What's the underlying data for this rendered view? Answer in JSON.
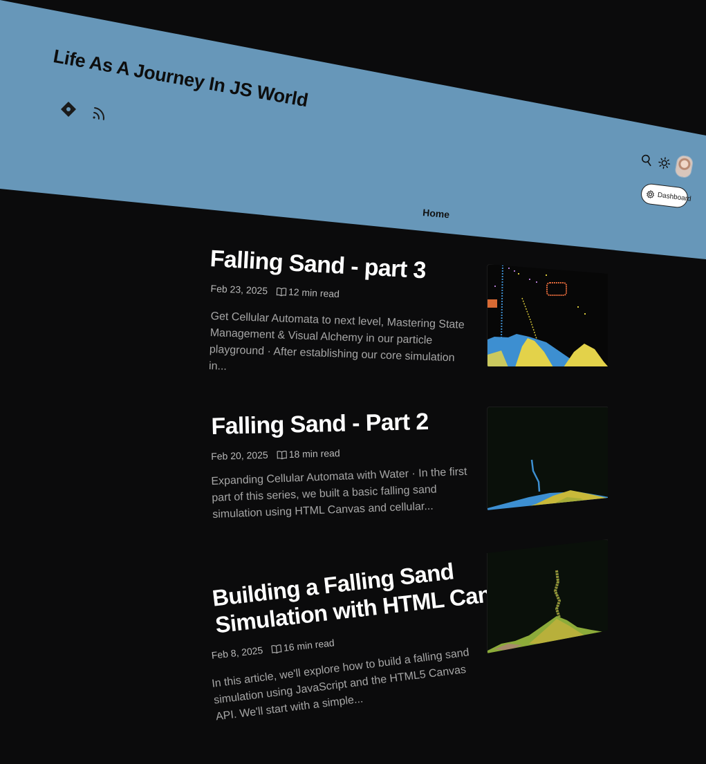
{
  "site": {
    "title": "Life As A Journey In JS World",
    "social": [
      "diamond-icon",
      "rss-icon"
    ]
  },
  "toolbar": {
    "icons": [
      "search-icon",
      "sun-icon",
      "avatar"
    ],
    "dashboard_label": "Dashboard"
  },
  "nav": {
    "home_label": "Home"
  },
  "colors": {
    "header_bg": "#6797b9",
    "page_bg": "#0b0b0c",
    "sand": "#d9c93a",
    "water": "#3d8fd1"
  },
  "posts": [
    {
      "title": "Falling Sand - part 3",
      "date": "Feb 23, 2025",
      "read_time": "12 min read",
      "excerpt": "Get Cellular Automata to next level, Mastering State Management & Visual Alchemy in our particle playground · After establishing our core simulation in..."
    },
    {
      "title": "Falling Sand - Part 2",
      "date": "Feb 20, 2025",
      "read_time": "18 min read",
      "excerpt": "Expanding Cellular Automata with Water · In the first part of this series, we built a basic falling sand simulation using HTML Canvas and cellular..."
    },
    {
      "title_line1": "Building a Falling Sand",
      "title_line2": "Simulation with HTML Canvas",
      "date": "Feb 8, 2025",
      "read_time": "16 min read",
      "excerpt": "In this article, we'll explore how to build a falling sand simulation using JavaScript and the HTML5 Canvas API. We'll start with a simple..."
    }
  ]
}
